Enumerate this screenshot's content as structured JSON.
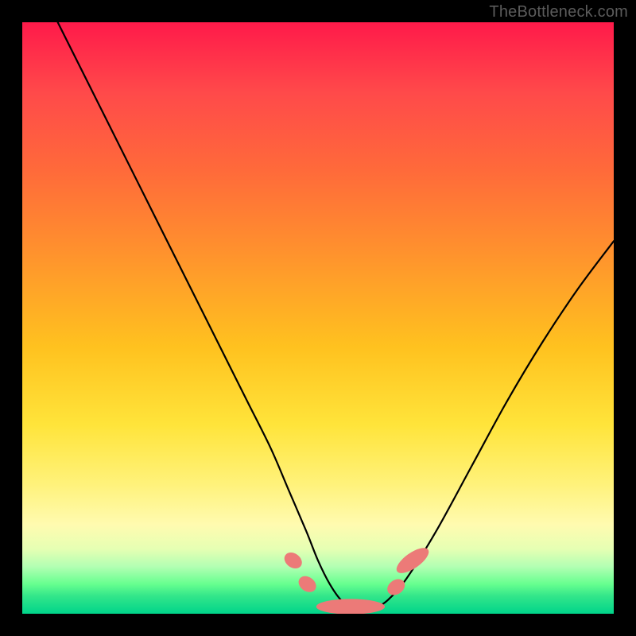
{
  "watermark": "TheBottleneck.com",
  "colors": {
    "background": "#000000",
    "curve": "#000000",
    "marker_fill": "#ec7a78",
    "marker_stroke": "#ec7a78"
  },
  "chart_data": {
    "type": "line",
    "title": "",
    "xlabel": "",
    "ylabel": "",
    "xlim": [
      0,
      100
    ],
    "ylim": [
      0,
      100
    ],
    "grid": false,
    "series": [
      {
        "name": "bottleneck-curve",
        "x": [
          6,
          10,
          14,
          18,
          22,
          26,
          30,
          34,
          38,
          42,
          45,
          48,
          50,
          52,
          54,
          56,
          58,
          60,
          62,
          65,
          70,
          76,
          82,
          88,
          94,
          100
        ],
        "y": [
          100,
          92,
          84,
          76,
          68,
          60,
          52,
          44,
          36,
          28,
          21,
          14,
          9,
          5,
          2.2,
          1,
          1,
          1.2,
          2.5,
          6,
          14,
          25,
          36,
          46,
          55,
          63
        ]
      }
    ],
    "markers": [
      {
        "name": "left-cluster-dot-1",
        "shape": "pill",
        "cx": 45.8,
        "cy": 9.0,
        "rx": 1.2,
        "ry": 1.6,
        "angle": -55
      },
      {
        "name": "left-cluster-dot-2",
        "shape": "pill",
        "cx": 48.2,
        "cy": 5.0,
        "rx": 1.2,
        "ry": 1.6,
        "angle": -55
      },
      {
        "name": "bottom-bar",
        "shape": "pill",
        "cx": 55.5,
        "cy": 1.2,
        "rx": 5.8,
        "ry": 1.3,
        "angle": 0
      },
      {
        "name": "right-cluster-dot-1",
        "shape": "pill",
        "cx": 63.2,
        "cy": 4.5,
        "rx": 1.2,
        "ry": 1.6,
        "angle": 55
      },
      {
        "name": "right-cluster-pill",
        "shape": "pill",
        "cx": 66.0,
        "cy": 9.0,
        "rx": 1.3,
        "ry": 3.2,
        "angle": 55
      }
    ]
  }
}
